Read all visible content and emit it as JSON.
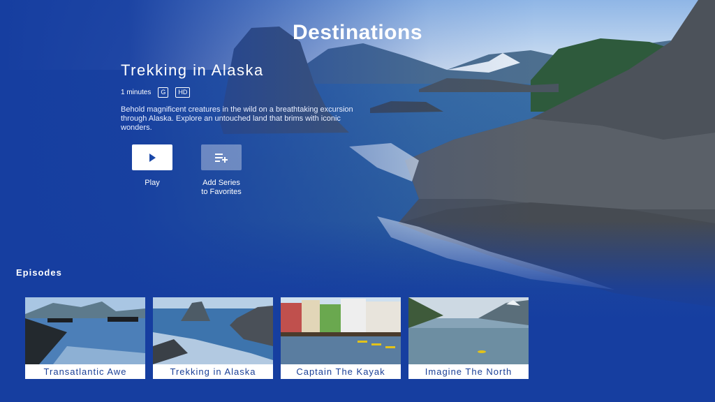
{
  "page": {
    "title": "Destinations"
  },
  "feature": {
    "title": "Trekking in Alaska",
    "duration": "1 minutes",
    "rating": "G",
    "quality": "HD",
    "description": "Behold magnificent creatures in the wild on a breathtaking excursion through Alaska. Explore an untouched land that brims with iconic wonders."
  },
  "actions": {
    "play_label": "Play",
    "favorites_label": "Add Series\nto Favorites"
  },
  "episodes": {
    "heading": "Episodes",
    "items": [
      {
        "title": "Transatlantic Awe"
      },
      {
        "title": "Trekking in Alaska"
      },
      {
        "title": "Captain The Kayak"
      },
      {
        "title": "Imagine The North"
      }
    ]
  },
  "colors": {
    "background": "#1a48a8",
    "card_text": "#1a3f96"
  }
}
